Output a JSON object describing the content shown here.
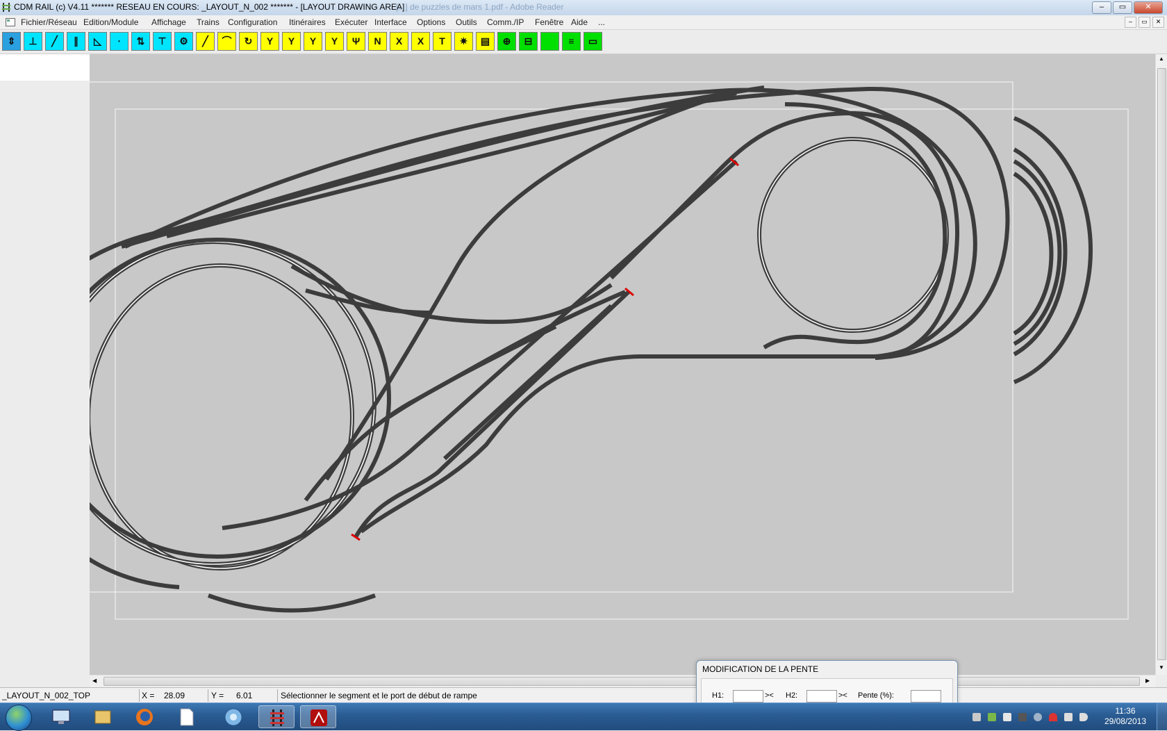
{
  "window": {
    "title": "CDM RAIL (c) V4.11      ******* RESEAU EN COURS: _LAYOUT_N_002 ******* - [LAYOUT DRAWING AREA]",
    "faded_title": "[...] de puzzles de mars 1.pdf - Adobe Reader",
    "minimize": "–",
    "maximize": "▭",
    "close": "✕"
  },
  "menu": {
    "items": [
      "Fichier/Réseau",
      "Edition/Module",
      "Affichage",
      "Trains",
      "Configuration",
      "Itinéraires",
      "Exécuter",
      "Interface",
      "Options",
      "Outils",
      "Comm./IP",
      "Fenêtre",
      "Aide",
      "..."
    ],
    "mdi_minimize": "–",
    "mdi_restore": "▭",
    "mdi_close": "✕"
  },
  "toolbar": {
    "tools": [
      {
        "name": "select-mode-tool",
        "color": "#2aa0e0"
      },
      {
        "name": "pointer-tool",
        "color": "#00e5ff"
      },
      {
        "name": "single-track-tool",
        "color": "#00e5ff"
      },
      {
        "name": "double-track-tool",
        "color": "#00e5ff"
      },
      {
        "name": "angle-tool",
        "color": "#00e5ff"
      },
      {
        "name": "node-tool",
        "color": "#00e5ff"
      },
      {
        "name": "height-tool",
        "color": "#00e5ff"
      },
      {
        "name": "level-tool",
        "color": "#00e5ff"
      },
      {
        "name": "turntable-tool",
        "color": "#00e5ff"
      },
      {
        "name": "straight-track-tool",
        "color": "#ffff00"
      },
      {
        "name": "curve-track-tool",
        "color": "#ffff00"
      },
      {
        "name": "loop-track-tool",
        "color": "#ffff00"
      },
      {
        "name": "right-turnout-tool",
        "color": "#ffff00"
      },
      {
        "name": "left-turnout-tool",
        "color": "#ffff00"
      },
      {
        "name": "curved-turnout-tool",
        "color": "#ffff00"
      },
      {
        "name": "wye-turnout-tool",
        "color": "#ffff00"
      },
      {
        "name": "three-way-turnout-tool",
        "color": "#ffff00"
      },
      {
        "name": "double-slip-tool",
        "color": "#ffff00"
      },
      {
        "name": "crossing-tool",
        "color": "#ffff00"
      },
      {
        "name": "diamond-crossing-tool",
        "color": "#ffff00"
      },
      {
        "name": "buffer-stop-tool",
        "color": "#ffff00"
      },
      {
        "name": "sensor-tool",
        "color": "#ffff00"
      },
      {
        "name": "catalog-tool",
        "color": "#ffff00"
      },
      {
        "name": "signal-tool",
        "color": "#00e000"
      },
      {
        "name": "block-tool",
        "color": "#00e000"
      },
      {
        "name": "green-block-tool",
        "color": "#00e000"
      },
      {
        "name": "multi-track-tool",
        "color": "#00e000"
      },
      {
        "name": "ruler-tool",
        "color": "#00e000"
      }
    ]
  },
  "status": {
    "layer": "_LAYOUT_N_002_TOP",
    "x_label": "X =",
    "x_value": "28.09",
    "y_label": "Y =",
    "y_value": "6.01",
    "message": "Sélectionner le segment et le port de début de rampe"
  },
  "dialog": {
    "title": "MODIFICATION DE LA PENTE",
    "h1_label": "H1:",
    "h2_label": "H2:",
    "swap1": "><",
    "swap2": "><",
    "slope_label": "Pente (%):"
  },
  "taskbar": {
    "time": "11:36",
    "date": "29/08/2013",
    "items": [
      "start-orb",
      "computer-app",
      "explorer-app",
      "firefox-app",
      "notepad-app",
      "network-app",
      "cdm-rail-app",
      "acrobat-app"
    ]
  },
  "colors": {
    "canvas": "#c8c8c8",
    "track": "#3c3c3c",
    "rail_highlight": "#ffffff",
    "buffer_stop": "#dd0000",
    "taskbar": "#2a5b92"
  }
}
